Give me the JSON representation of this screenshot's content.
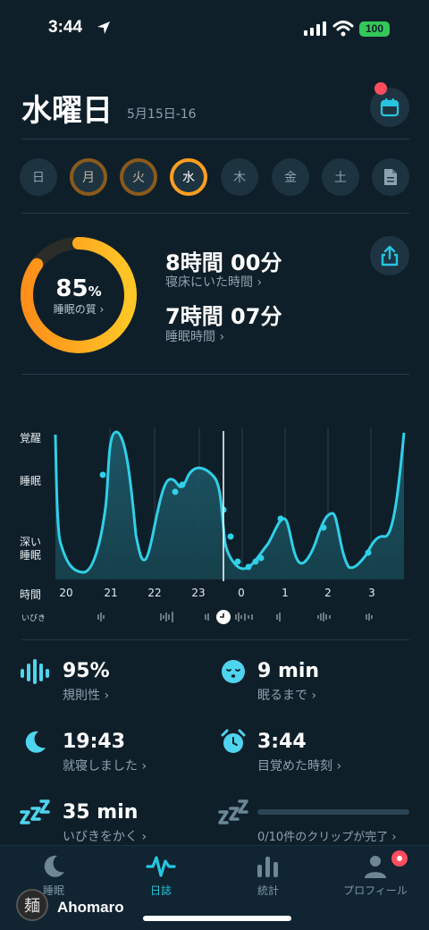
{
  "status_bar": {
    "time": "3:44",
    "battery": "100"
  },
  "header": {
    "day": "水曜日",
    "date_range": "5月15日-16"
  },
  "week": [
    "日",
    "月",
    "火",
    "水",
    "木",
    "金",
    "土"
  ],
  "score": {
    "value": "85",
    "unit": "%",
    "label": "睡眠の質 ›",
    "fraction": 0.85
  },
  "in_bed": {
    "value": "8時間 00分",
    "label": "寝床にいた時間 ›"
  },
  "asleep": {
    "value": "7時間 07分",
    "label": "睡眠時間 ›"
  },
  "chart": {
    "y_labels": {
      "awake": "覚醒",
      "sleep": "睡眠",
      "deep_1": "深い",
      "deep_2": "睡眠"
    },
    "x_title": "時間",
    "hours": [
      "20",
      "21",
      "22",
      "23",
      "0",
      "1",
      "2",
      "3"
    ],
    "snore_label": "いびき"
  },
  "stats": {
    "regularity": {
      "value": "95%",
      "label": "規則性 ›"
    },
    "fall_asleep": {
      "value": "9 min",
      "label": "眠るまで ›"
    },
    "bedtime": {
      "value": "19:43",
      "label": "就寝しました ›"
    },
    "wake": {
      "value": "3:44",
      "label": "目覚めた時刻 ›"
    },
    "snoring": {
      "value": "35 min",
      "label": "いびきをかく ›"
    },
    "clips": {
      "label": "0/10件のクリップが完了 ›",
      "progress": 0
    }
  },
  "tabs": [
    {
      "label": "睡眠"
    },
    {
      "label": "日誌"
    },
    {
      "label": "統計"
    },
    {
      "label": "プロフィール"
    }
  ],
  "watermark": {
    "name": "Ahomaro",
    "badge": "麺"
  },
  "colors": {
    "accent": "#27c5e0",
    "score_orange": "#ff9e1f",
    "score_yellow": "#ffc21f",
    "background": "#0f1f29"
  }
}
